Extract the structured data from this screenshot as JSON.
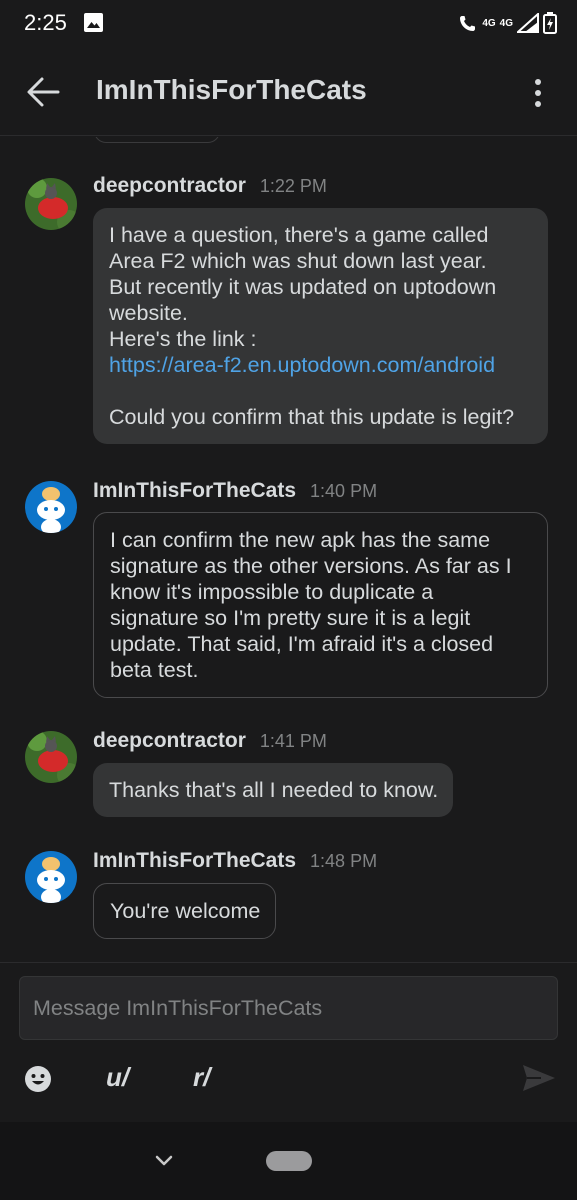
{
  "status_bar": {
    "time": "2:25",
    "network_left": "4G",
    "network_right": "4G"
  },
  "header": {
    "title": "ImInThisForTheCats",
    "back_icon": "arrow-left-icon",
    "more_icon": "more-vertical-icon"
  },
  "messages": [
    {
      "username": "deepcontractor",
      "time": "1:22 PM",
      "style": "filled",
      "lines": [
        "I have a question, there's a game called",
        "Area F2 which was shut down last year.",
        "But recently it was updated on uptodown",
        "website.",
        "Here's the link :"
      ],
      "link": "https://area-f2.en.uptodown.com/android",
      "after_link": "Could you confirm that this update is legit?"
    },
    {
      "username": "ImInThisForTheCats",
      "time": "1:40 PM",
      "style": "outlined",
      "lines": [
        "I can confirm the new apk has the same",
        "signature as the other versions. As far as I",
        "know it's impossible to duplicate a",
        "signature so I'm pretty sure it is a legit",
        "update. That said, I'm afraid it's a closed",
        "beta test."
      ]
    },
    {
      "username": "deepcontractor",
      "time": "1:41 PM",
      "style": "filled",
      "lines": [
        "Thanks that's all I needed to know."
      ]
    },
    {
      "username": "ImInThisForTheCats",
      "time": "1:48 PM",
      "style": "outlined",
      "lines": [
        "You're welcome"
      ]
    }
  ],
  "composer": {
    "placeholder": "Message ImInThisForTheCats",
    "user_mention_label": "u/",
    "subreddit_mention_label": "r/",
    "emoji_icon": "emoji-icon",
    "send_icon": "send-icon"
  },
  "colors": {
    "background": "#1a1a1b",
    "bubble_fill": "#343536",
    "link": "#4fa3e6",
    "meta_text": "#818384"
  }
}
